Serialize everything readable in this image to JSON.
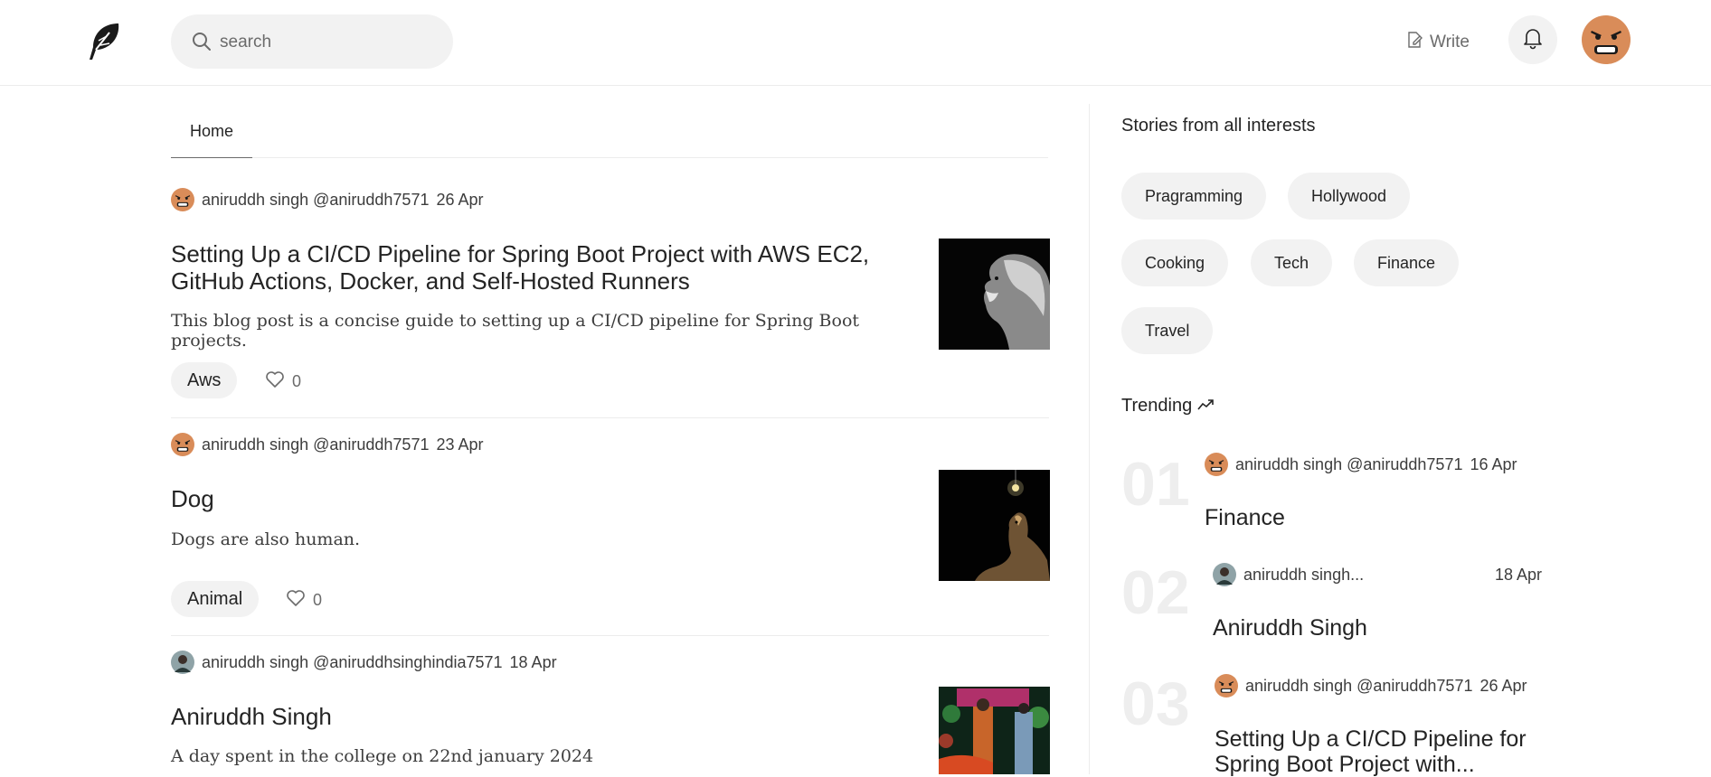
{
  "header": {
    "logo": "feather-logo",
    "search_placeholder": "search",
    "write_label": "Write",
    "icons": [
      "search-icon",
      "write-icon",
      "bell-icon"
    ]
  },
  "tabs": [
    {
      "label": "Home"
    }
  ],
  "posts": [
    {
      "author": "aniruddh singh @aniruddh7571",
      "date": "26 Apr",
      "title": "Setting Up a CI/CD Pipeline for Spring Boot Project with AWS EC2, GitHub Actions, Docker, and Self-Hosted Runners",
      "description": "This blog post is a concise guide to setting up a CI/CD pipeline for Spring Boot projects.",
      "tag": "Aws",
      "likes": "0"
    },
    {
      "author": "aniruddh singh @aniruddh7571",
      "date": "23 Apr",
      "title": "Dog",
      "description": "Dogs are also human.",
      "tag": "Animal",
      "likes": "0"
    },
    {
      "author": "aniruddh singh @aniruddhsinghindia7571",
      "date": "18 Apr",
      "title": "Aniruddh Singh",
      "description": "A day spent in the college on 22nd january 2024"
    }
  ],
  "sidebar": {
    "interests_heading": "Stories from all interests",
    "interests": [
      "Pragramming",
      "Hollywood",
      "Cooking",
      "Tech",
      "Finance",
      "Travel"
    ],
    "trending_heading": "Trending",
    "trending": [
      {
        "num": "01",
        "author": "aniruddh singh @aniruddh7571",
        "date": "16 Apr",
        "title": "Finance"
      },
      {
        "num": "02",
        "author": "aniruddh singh...",
        "date": "18 Apr",
        "title": "Aniruddh Singh"
      },
      {
        "num": "03",
        "author": "aniruddh singh @aniruddh7571",
        "date": "26 Apr",
        "title": "Setting Up a CI/CD Pipeline for Spring Boot Project with..."
      }
    ]
  },
  "colors": {
    "avatar": "#d98c59",
    "chip_bg": "#f2f2f2",
    "text": "#242424",
    "muted": "#6b6b6b"
  }
}
